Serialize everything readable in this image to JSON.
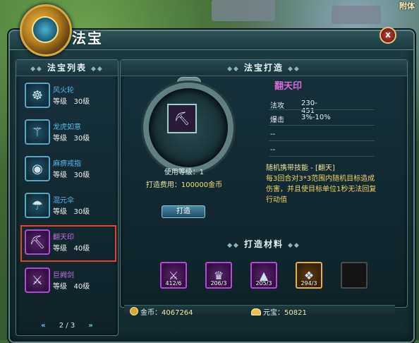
{
  "background": {
    "label": "附体"
  },
  "window": {
    "title": "法宝",
    "close_label": "x"
  },
  "list_panel": {
    "title": "法宝列表",
    "items": [
      {
        "name": "风火轮",
        "level_label": "等级",
        "level": "30级",
        "quality": "blue",
        "icon": "wheel-icon"
      },
      {
        "name": "龙虎如意",
        "level_label": "等级",
        "level": "30级",
        "quality": "blue",
        "icon": "scepter-icon"
      },
      {
        "name": "麻痹戒指",
        "level_label": "等级",
        "level": "30级",
        "quality": "blue",
        "icon": "ring-icon"
      },
      {
        "name": "混元伞",
        "level_label": "等级",
        "level": "30级",
        "quality": "blue",
        "icon": "umbrella-icon"
      },
      {
        "name": "翻天印",
        "level_label": "等级",
        "level": "40级",
        "quality": "purple",
        "icon": "seal-icon",
        "selected": true
      },
      {
        "name": "巨阙剑",
        "level_label": "等级",
        "level": "40级",
        "quality": "purple",
        "icon": "sword-icon"
      }
    ],
    "pager": {
      "prev": "«",
      "page": "2 / 3",
      "next": "»"
    }
  },
  "forge_panel": {
    "title": "法宝打造",
    "item_name": "翻天印",
    "use_level": "使用等级：1",
    "cost_label": "打造费用：",
    "cost_value": "100000金币",
    "forge_button": "打造",
    "stats": [
      {
        "label": "法攻",
        "value": "230-451"
      },
      {
        "label": "爆击",
        "value": "3%-10%"
      },
      {
        "label": "--",
        "value": ""
      },
      {
        "label": "--",
        "value": ""
      }
    ],
    "skill_title": "随机携带技能 - [翻天]",
    "skill_desc": "每3回合对3*3范围内随机目标造成伤害，并且使目标单位1秒无法回复行动值",
    "materials_title": "打造材料",
    "materials": [
      {
        "count": "412/6",
        "quality": "purple",
        "icon": "crossed-weapons-icon"
      },
      {
        "count": "206/3",
        "quality": "purple",
        "icon": "crown-icon"
      },
      {
        "count": "205/3",
        "quality": "purple",
        "icon": "mountain-icon"
      },
      {
        "count": "294/3",
        "quality": "gold",
        "icon": "chest-icon"
      },
      {
        "count": "",
        "quality": "empty",
        "icon": "empty-slot-icon"
      }
    ]
  },
  "currency": {
    "gold_label": "金币：",
    "gold_value": "4067264",
    "yuanbao_label": "元宝：",
    "yuanbao_value": "50821"
  }
}
